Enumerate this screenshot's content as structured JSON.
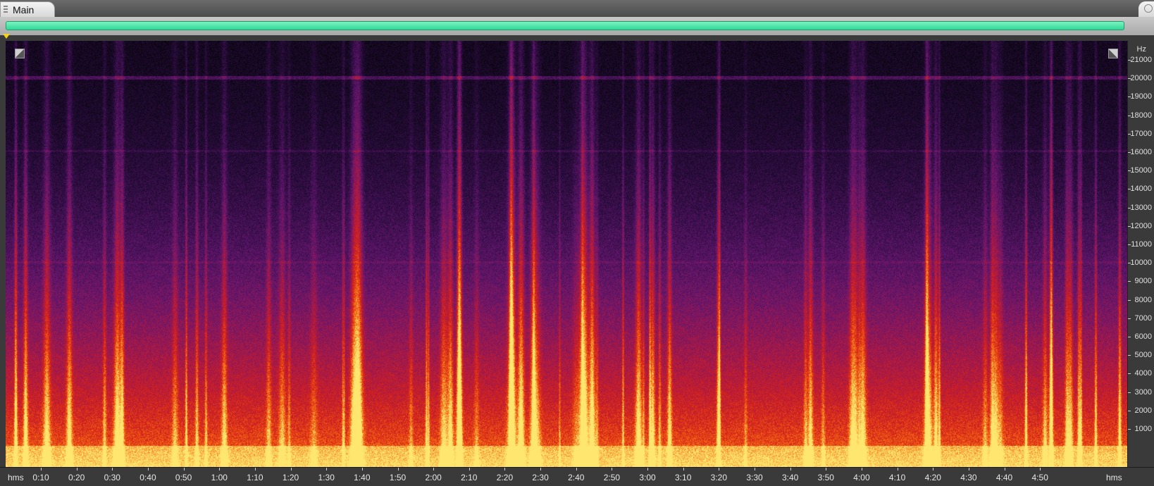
{
  "tabs": {
    "main": "Main"
  },
  "frequency_axis": {
    "unit": "Hz",
    "ticks": [
      "21000",
      "20000",
      "19000",
      "18000",
      "17000",
      "16000",
      "15000",
      "14000",
      "13000",
      "12000",
      "11000",
      "10000",
      "9000",
      "8000",
      "7000",
      "6000",
      "5000",
      "4000",
      "3000",
      "2000",
      "1000"
    ]
  },
  "time_axis": {
    "unit_left": "hms",
    "unit_right": "hms",
    "ticks": [
      "0:10",
      "0:20",
      "0:30",
      "0:40",
      "0:50",
      "1:00",
      "1:10",
      "1:20",
      "1:30",
      "1:40",
      "1:50",
      "2:00",
      "2:10",
      "2:20",
      "2:30",
      "2:40",
      "2:50",
      "3:00",
      "3:10",
      "3:20",
      "3:30",
      "3:40",
      "3:50",
      "4:00",
      "4:10",
      "4:20",
      "4:30",
      "4:40",
      "4:50"
    ]
  },
  "colors": {
    "overview_range": "#2ed897",
    "playhead": "#f2d21c",
    "spectrogram_low": "#0a0610",
    "spectrogram_mid": "#7a1a6e",
    "spectrogram_high": "#ffd84a"
  }
}
